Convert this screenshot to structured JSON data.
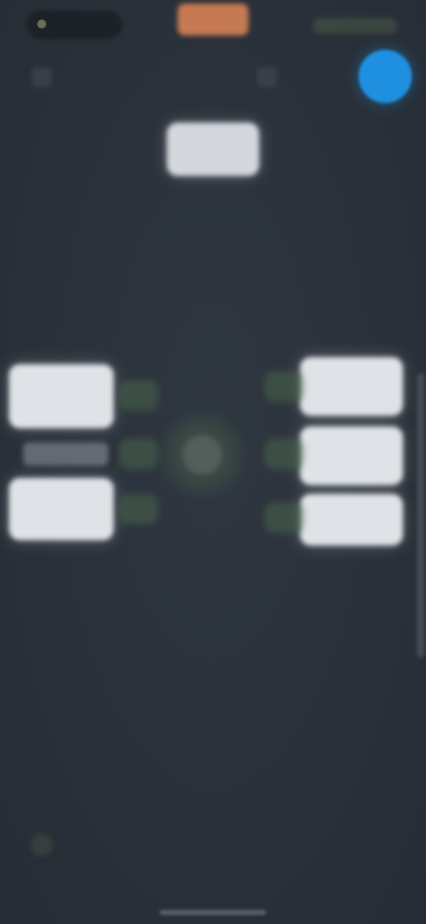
{
  "status_bar": {},
  "toolbar": {},
  "top_chip": {},
  "options": {
    "left": [
      {},
      {}
    ],
    "right": [
      {},
      {},
      {}
    ]
  },
  "icons": {
    "status_left": "status-pill-icon",
    "status_center": "status-center-pill",
    "toolbar_left": "menu-icon",
    "toolbar_mid": "action-icon",
    "avatar": "avatar",
    "hub": "hub-icon",
    "corner": "corner-icon"
  },
  "colors": {
    "background": "#2b323b",
    "accent_blue": "#1f8fe0",
    "accent_orange": "#c67a52",
    "connector_green": "#49654a",
    "card": "#dfe2e6"
  }
}
